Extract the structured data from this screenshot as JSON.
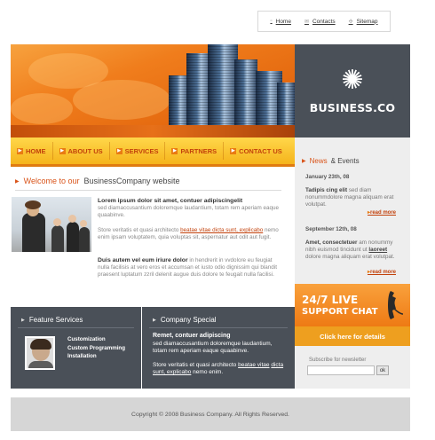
{
  "top_links": [
    {
      "label": "Home",
      "icon": "home-icon"
    },
    {
      "label": "Contacts",
      "icon": "mail-icon"
    },
    {
      "label": "Sitemap",
      "icon": "sitemap-icon"
    }
  ],
  "logo": {
    "text": "BUSINESS.CO",
    "icon": "starburst-icon"
  },
  "nav": {
    "items": [
      "HOME",
      "ABOUT US",
      "SERVICES",
      "PARTNERS",
      "CONTACT US"
    ]
  },
  "news": {
    "title_highlight": "News",
    "title_rest": "& Events",
    "items": [
      {
        "date": "January 23th, 08",
        "bold": "Tadipis cing elit",
        "text": " sed diam nonummdolore magna aliquam erat volutpat.",
        "more": "read more"
      },
      {
        "date": "September 12th, 08",
        "bold": "Amet, consectetuer",
        "text_a": " am nonummy nibh euismod tincidunt ut ",
        "link": "laoreet",
        "text_b": " dolore magna aliquam erat volutpat.",
        "more": "read more"
      }
    ]
  },
  "support": {
    "line1": "24/7 LIVE",
    "line2": "SUPPORT CHAT",
    "button": "Click here for details",
    "icon": "phone-icon"
  },
  "newsletter": {
    "label": "Subscribe for newsletter",
    "input_value": "",
    "button": "ok"
  },
  "welcome": {
    "highlight": "Welcome to our",
    "rest": "BusinessCompany website"
  },
  "paragraphs": {
    "p1_bold": "Lorem ipsum dolor sit amet, contuer adipiscingelit",
    "p1_text": "sed diamaccusantium doloremque laudantium, totam rem aperiam eaque quaabinve.",
    "p2_a": "Store veritatis et quasi architecto ",
    "p2_link": "beatae vitae dicta sunt, explicabo",
    "p2_b": " nemo enim ipsam voluptatem, quia voluptas sit, aspernatur aut odit aut fugit.",
    "p3_bold": "Duis autem vel eum iriure dolor",
    "p3_text": " in hendrerit in vvdolore eu feugiat nulla facilisis at vero eros et accumsan et iusto odio dignissim qui blandit praesent luptatum zzril delenit augue duis dolore te feugait nulla facilisi."
  },
  "feature": {
    "title": "Feature Services",
    "items": [
      "Customization",
      "Custom Programming",
      "Installation"
    ]
  },
  "special": {
    "title": "Company Special",
    "heading": "Remet, contuer adipiscing",
    "text1": "sed diamaccusantium doloremque laudantium, totam rem aperiam eaque quaabinve.",
    "text2_a": "Store veritatis et quasi architecto ",
    "text2_link1": "beatae vitae",
    "text2_link2": "dicta sunt, explicabo",
    "text2_b": " nemo enim."
  },
  "footer": {
    "text": "Copyright © 2008 Business Company. All Rights Reserved."
  },
  "colors": {
    "accent_orange": "#d9541a",
    "nav_yellow": "#f5b41c",
    "dark_panel": "#4a5058",
    "footer_grey": "#d6d6d6"
  }
}
